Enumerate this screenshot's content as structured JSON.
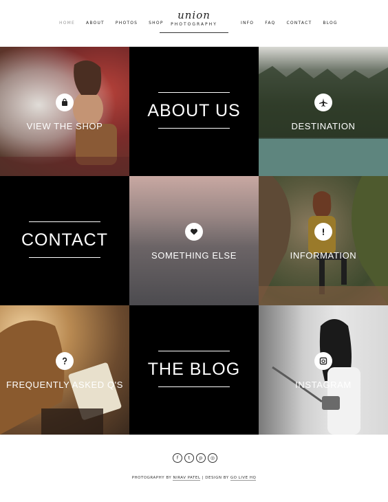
{
  "nav": {
    "left": [
      "HOME",
      "ABOUT",
      "PHOTOS",
      "SHOP"
    ],
    "right": [
      "INFO",
      "FAQ",
      "CONTACT",
      "BLOG"
    ]
  },
  "logo": {
    "script": "union",
    "sub": "PHOTOGRAPHY"
  },
  "tiles": {
    "shop": "VIEW THE SHOP",
    "about": "ABOUT US",
    "destination": "DESTINATION",
    "contact": "CONTACT",
    "something": "SOMETHING ELSE",
    "information": "INFORMATION",
    "faq": "FREQUENTLY ASKED Q'S",
    "blog": "THE BLOG",
    "instagram": "INSTAGRAM"
  },
  "footer": {
    "social": [
      "facebook-icon",
      "twitter-icon",
      "pinterest-icon",
      "instagram-icon"
    ],
    "photo_prefix": "PHOTOGRAPHY BY",
    "photo_name": "NIRAV PATEL",
    "sep": "|",
    "design_prefix": "DESIGN BY",
    "design_name": "GO LIVE HQ"
  },
  "colors": {
    "tile_black": "#000000",
    "text": "#222222",
    "nav_active": "#999999"
  }
}
